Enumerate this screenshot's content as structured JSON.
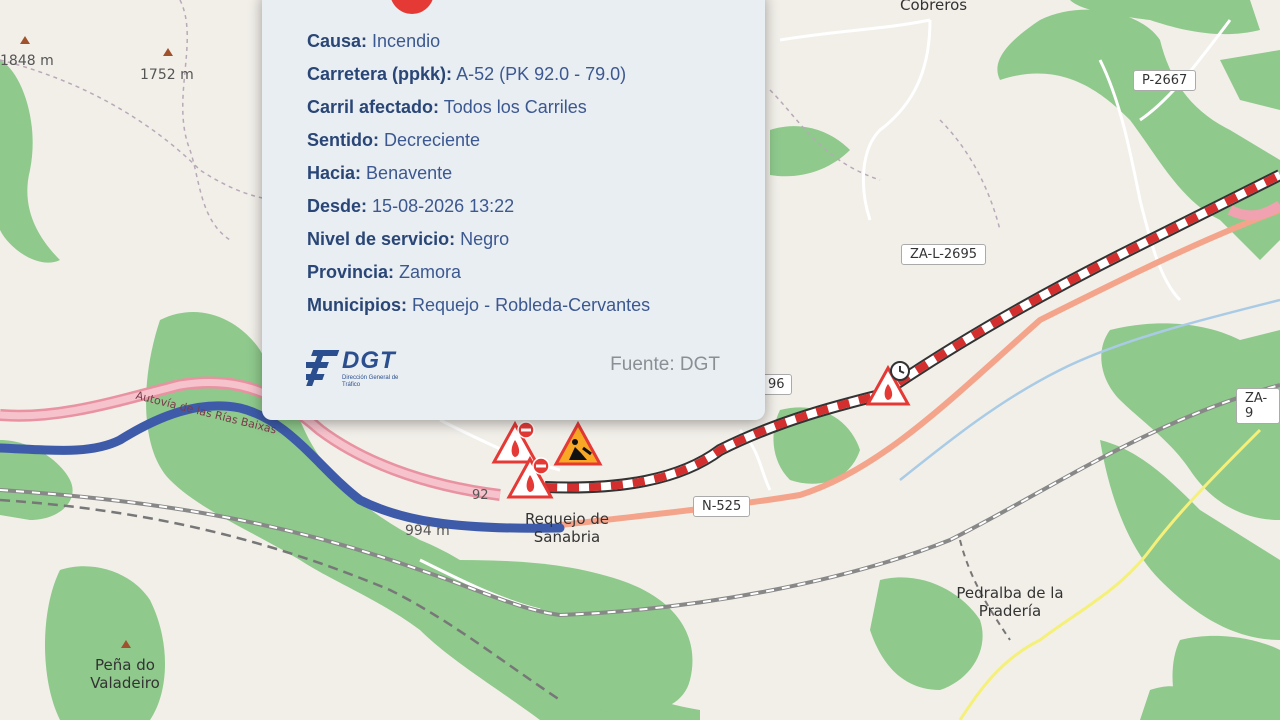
{
  "popup": {
    "rows": [
      {
        "key": "Causa:",
        "value": "Incendio"
      },
      {
        "key": "Carretera (ppkk):",
        "value": "A-52 (PK 92.0 - 79.0)"
      },
      {
        "key": "Carril afectado:",
        "value": "Todos los Carriles"
      },
      {
        "key": "Sentido:",
        "value": "Decreciente"
      },
      {
        "key": "Hacia:",
        "value": "Benavente"
      },
      {
        "key": "Desde:",
        "value": "15-08-2026 13:22"
      },
      {
        "key": "Nivel de servicio:",
        "value": "Negro"
      },
      {
        "key": "Provincia:",
        "value": "Zamora"
      },
      {
        "key": "Municipios:",
        "value": "Requejo - Robleda-Cervantes"
      }
    ],
    "logo_text": "DGT",
    "logo_sub": "Dirección General de Tráfico",
    "source": "Fuente: DGT",
    "colors": {
      "incident_red": "#e53935",
      "text_blue": "#2f4a7a"
    }
  },
  "map": {
    "places": {
      "cobreros": "Cobreros",
      "requejo": "Requejo de Sanabria",
      "pedralba": "Pedralba de la Pradería",
      "pena": "Peña do Valadeiro"
    },
    "elevations": {
      "e1848": "1848 m",
      "e1752": "1752 m",
      "e994": "994 m"
    },
    "shields": {
      "p2667": "P-2667",
      "za2695": "ZA-L-2695",
      "n525": "N-525",
      "za9": "ZA-9",
      "partial96": "96"
    },
    "road_name": "Autovía de las Rías Baixas",
    "pk_label": "92",
    "colors": {
      "motorway": "#e892a2",
      "trunk": "#f4a48a",
      "route_blue": "#3d5ba9",
      "closure_red": "#d32f2f",
      "forest": "#8cc58a",
      "background": "#f2efe9"
    }
  }
}
